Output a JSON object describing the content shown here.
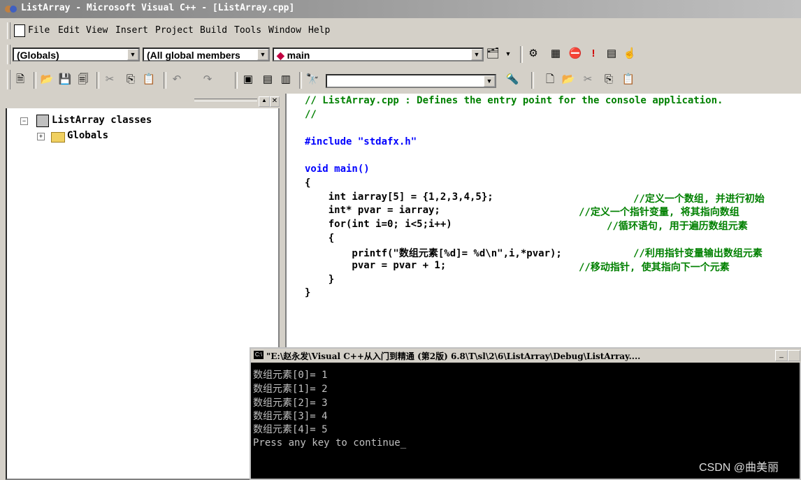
{
  "window": {
    "title": "ListArray - Microsoft Visual C++ - [ListArray.cpp]"
  },
  "menu": [
    {
      "label": "File"
    },
    {
      "label": "Edit"
    },
    {
      "label": "View"
    },
    {
      "label": "Insert"
    },
    {
      "label": "Project"
    },
    {
      "label": "Build"
    },
    {
      "label": "Tools"
    },
    {
      "label": "Window"
    },
    {
      "label": "Help"
    }
  ],
  "wizardbar": {
    "scope": "(Globals)",
    "members": "(All global members",
    "function": "main"
  },
  "find_combo": {
    "value": ""
  },
  "workspace": {
    "root": "ListArray classes",
    "child": "Globals"
  },
  "editor": {
    "lines": [
      "// ListArray.cpp : Defines the entry point for the console application.",
      "//",
      "",
      "#include \"stdafx.h\"",
      "",
      "void main()",
      "{",
      "    int iarray[5] = {1,2,3,4,5};",
      "    int* pvar = iarray;",
      "    for(int i=0; i<5;i++)",
      "    {",
      "        printf(\"数组元素[%d]= %d\\n\",i,*pvar);",
      "        pvar = pvar + 1;",
      "    }",
      "}"
    ],
    "comments": {
      "c7": "//定义一个数组, 并进行初始",
      "c8": "//定义一个指针变量, 将其指向数组",
      "c9": "//循环语句, 用于遍历数组元素",
      "c11": "//利用指针变量输出数组元素",
      "c12": "//移动指针, 使其指向下一个元素"
    }
  },
  "console": {
    "title": "\"E:\\赵永发\\Visual C++从入门到精通 (第2版) 6.8\\T\\sl\\2\\6\\ListArray\\Debug\\ListArray....",
    "lines": [
      "数组元素[0]= 1",
      "数组元素[1]= 2",
      "数组元素[2]= 3",
      "数组元素[3]= 4",
      "数组元素[4]= 5",
      "Press any key to continue_"
    ]
  },
  "watermark": "CSDN @曲美丽",
  "colors": {
    "keyword": "#0000ff",
    "comment": "#008000",
    "console_bg": "#000000",
    "console_fg": "#c0c0c0"
  }
}
